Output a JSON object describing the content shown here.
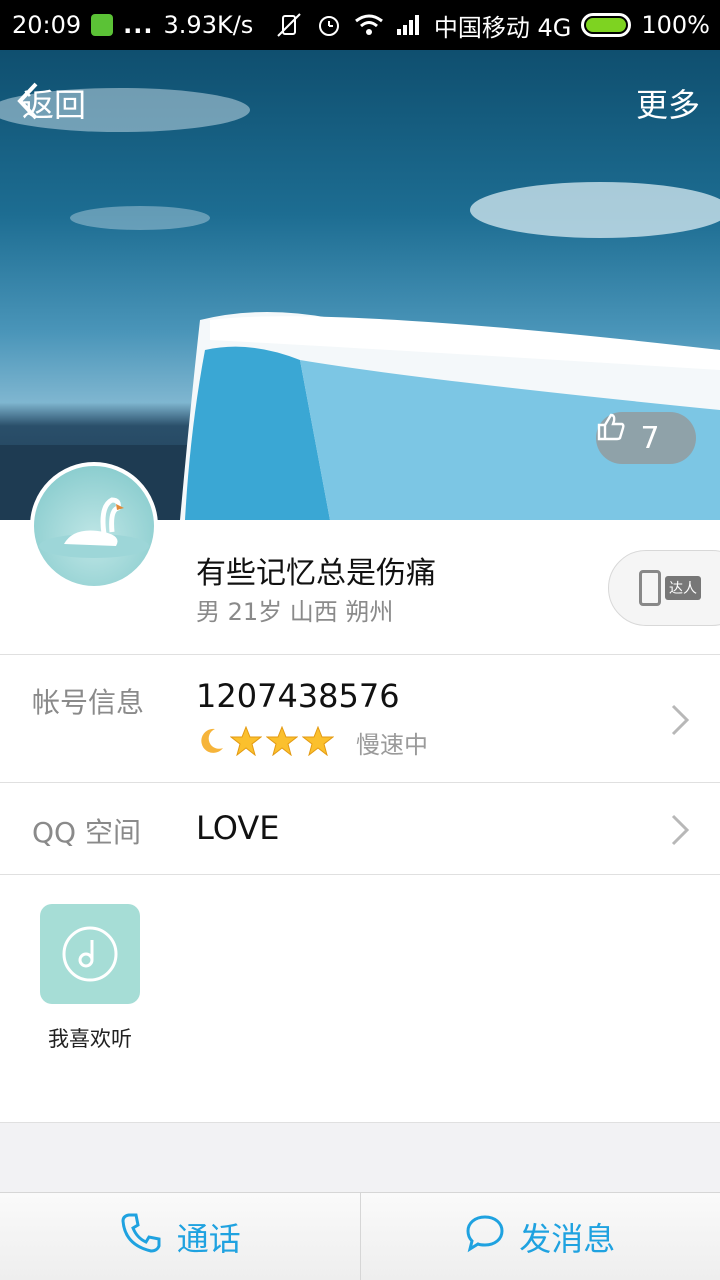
{
  "status_bar": {
    "time": "20:09",
    "dots": "...",
    "net_speed": "3.93K/s",
    "carrier": "中国移动 4G",
    "battery": "100%",
    "icons": [
      "app-notification-icon",
      "mute-vibrate-icon",
      "alarm-icon",
      "wifi-icon",
      "signal-icon",
      "battery-icon"
    ]
  },
  "nav": {
    "back_label": "返回",
    "more_label": "更多"
  },
  "cover": {
    "likes": "7"
  },
  "profile": {
    "nickname": "有些记忆总是伤痛",
    "meta": "男 21岁 山西 朔州",
    "talent_tag": "达人"
  },
  "account": {
    "label": "帐号信息",
    "qq_number": "1207438576",
    "level_icons": [
      "moon-icon",
      "star-icon",
      "star-icon",
      "star-icon"
    ],
    "speed_text": "慢速中"
  },
  "qzone": {
    "label": "QQ 空间",
    "value": "LOVE"
  },
  "favorites": {
    "items": [
      {
        "label": "我喜欢听",
        "icon": "music-disc-icon"
      }
    ]
  },
  "bottom_bar": {
    "call_label": "通话",
    "message_label": "发消息"
  },
  "colors": {
    "accent": "#1fa2e0",
    "tile": "#a6ddd6",
    "label_gray": "#8a8a8a"
  }
}
